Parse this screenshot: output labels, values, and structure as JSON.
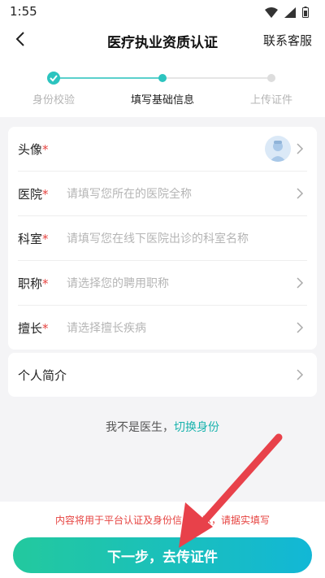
{
  "status": {
    "time": "1:55"
  },
  "header": {
    "title": "医疗执业资质认证",
    "service_label": "联系客服"
  },
  "steps": [
    {
      "label": "身份校验",
      "state": "done"
    },
    {
      "label": "填写基础信息",
      "state": "current"
    },
    {
      "label": "上传证件",
      "state": "pending"
    }
  ],
  "form": {
    "avatar": {
      "label": "头像",
      "required": "*"
    },
    "hospital": {
      "label": "医院",
      "required": "*",
      "placeholder": "请填写您所在的医院全称"
    },
    "department": {
      "label": "科室",
      "required": "*",
      "placeholder": "请填写您在线下医院出诊的科室名称"
    },
    "title": {
      "label": "职称",
      "required": "*",
      "placeholder": "请选择您的聘用职称"
    },
    "specialty": {
      "label": "擅长",
      "required": "*",
      "placeholder": "请选择擅长疾病"
    },
    "intro": {
      "label": "个人简介"
    }
  },
  "switch": {
    "text": "我不是医生，",
    "link": "切换身份"
  },
  "footer": {
    "notice": "内容将用于平台认证及身份信息展示，请据实填写",
    "next_label": "下一步，去传证件"
  },
  "colors": {
    "accent": "#19b3ad",
    "required": "#e64340",
    "annotation_arrow": "#e8414a"
  }
}
